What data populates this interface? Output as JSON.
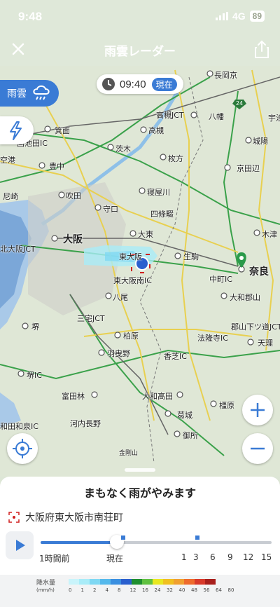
{
  "status": {
    "time": "9:48",
    "network": "4G",
    "battery": "89"
  },
  "nav": {
    "title": "雨雲レーダー"
  },
  "map": {
    "time": "09:40",
    "now_badge": "現在",
    "layer_label": "雨雲",
    "labels": [
      {
        "t": "長岡京"
      },
      {
        "t": "高槻JCT"
      },
      {
        "t": "八幡"
      },
      {
        "t": "宇治"
      },
      {
        "t": "箕面"
      },
      {
        "t": "高槻"
      },
      {
        "t": "城陽"
      },
      {
        "t": "国池田IC"
      },
      {
        "t": "茨木"
      },
      {
        "t": "空港"
      },
      {
        "t": "豊中"
      },
      {
        "t": "枚方"
      },
      {
        "t": "京田辺"
      },
      {
        "t": "尼崎"
      },
      {
        "t": "吹田"
      },
      {
        "t": "寝屋川"
      },
      {
        "t": "守口"
      },
      {
        "t": "四條畷"
      },
      {
        "t": "大阪"
      },
      {
        "t": "大東"
      },
      {
        "t": "木津"
      },
      {
        "t": "北大阪JCT"
      },
      {
        "t": "東大阪"
      },
      {
        "t": "生駒"
      },
      {
        "t": "奈良"
      },
      {
        "t": "東大阪南IC"
      },
      {
        "t": "中町IC"
      },
      {
        "t": "八尾"
      },
      {
        "t": "大和郡山"
      },
      {
        "t": "三宅JCT"
      },
      {
        "t": "郡山下ツ道JCT"
      },
      {
        "t": "堺"
      },
      {
        "t": "柏原"
      },
      {
        "t": "法隆寺IC"
      },
      {
        "t": "天理"
      },
      {
        "t": "羽曳野"
      },
      {
        "t": "香芝IC"
      },
      {
        "t": "堺IC"
      },
      {
        "t": "富田林"
      },
      {
        "t": "大和高田"
      },
      {
        "t": "橿原"
      },
      {
        "t": "葛城"
      },
      {
        "t": "和田和泉IC"
      },
      {
        "t": "河内長野"
      },
      {
        "t": "御所"
      },
      {
        "t": "金剛山"
      },
      {
        "t": "24"
      }
    ]
  },
  "sheet": {
    "title": "まもなく雨がやみます",
    "location": "大阪府東大阪市南荘町",
    "timeline": {
      "ticks": [
        "1時間前",
        "現在",
        "1",
        "3",
        "6",
        "9",
        "12",
        "15"
      ],
      "current_fraction": 0.33
    },
    "legend": {
      "title": "降水量",
      "unit": "(mm/h)",
      "values": [
        "0",
        "1",
        "2",
        "4",
        "8",
        "12",
        "16",
        "24",
        "32",
        "40",
        "48",
        "56",
        "64",
        "80"
      ],
      "colors": [
        "#c9f4fb",
        "#a9ecf8",
        "#7fd8f3",
        "#55b9ec",
        "#3a8fe0",
        "#2a5fce",
        "#1f8f2f",
        "#5fc140",
        "#e8e820",
        "#f0c020",
        "#f0a030",
        "#ee6b2c",
        "#d83a2a",
        "#a8201c"
      ]
    }
  }
}
